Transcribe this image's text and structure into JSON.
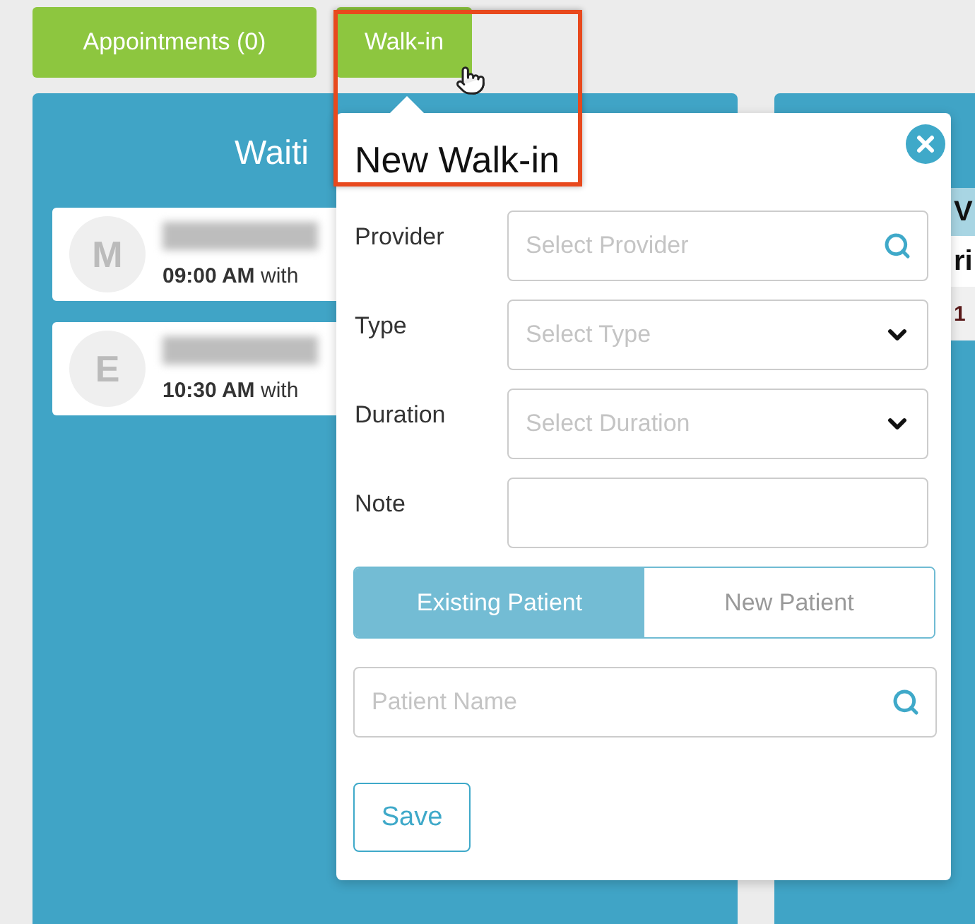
{
  "top_buttons": [
    {
      "label": "Appointments (0)"
    },
    {
      "label": "Walk-in"
    }
  ],
  "waiting_column": {
    "title": "Waiti",
    "cards": [
      {
        "initial": "M",
        "time": "09:00 AM",
        "suffix": "with"
      },
      {
        "initial": "E",
        "time": "10:30 AM",
        "suffix": "with"
      }
    ]
  },
  "right_column": {
    "card": {
      "line_1": "V",
      "line_2": "ri",
      "line_3": "1"
    }
  },
  "walk_in_popup": {
    "title": "New Walk-in",
    "fields": [
      {
        "label": "Provider",
        "kind": "search",
        "placeholder": "Select Provider"
      },
      {
        "label": "Type",
        "kind": "select",
        "placeholder": "Select Type"
      },
      {
        "label": "Duration",
        "kind": "select",
        "placeholder": "Select Duration"
      },
      {
        "label": "Note",
        "kind": "text"
      }
    ],
    "patient_tabs": [
      {
        "label": "Existing Patient",
        "selected": true
      },
      {
        "label": "New Patient",
        "selected": false
      }
    ],
    "patient_search": {
      "placeholder": "Patient Name"
    },
    "save_button": "Save"
  }
}
